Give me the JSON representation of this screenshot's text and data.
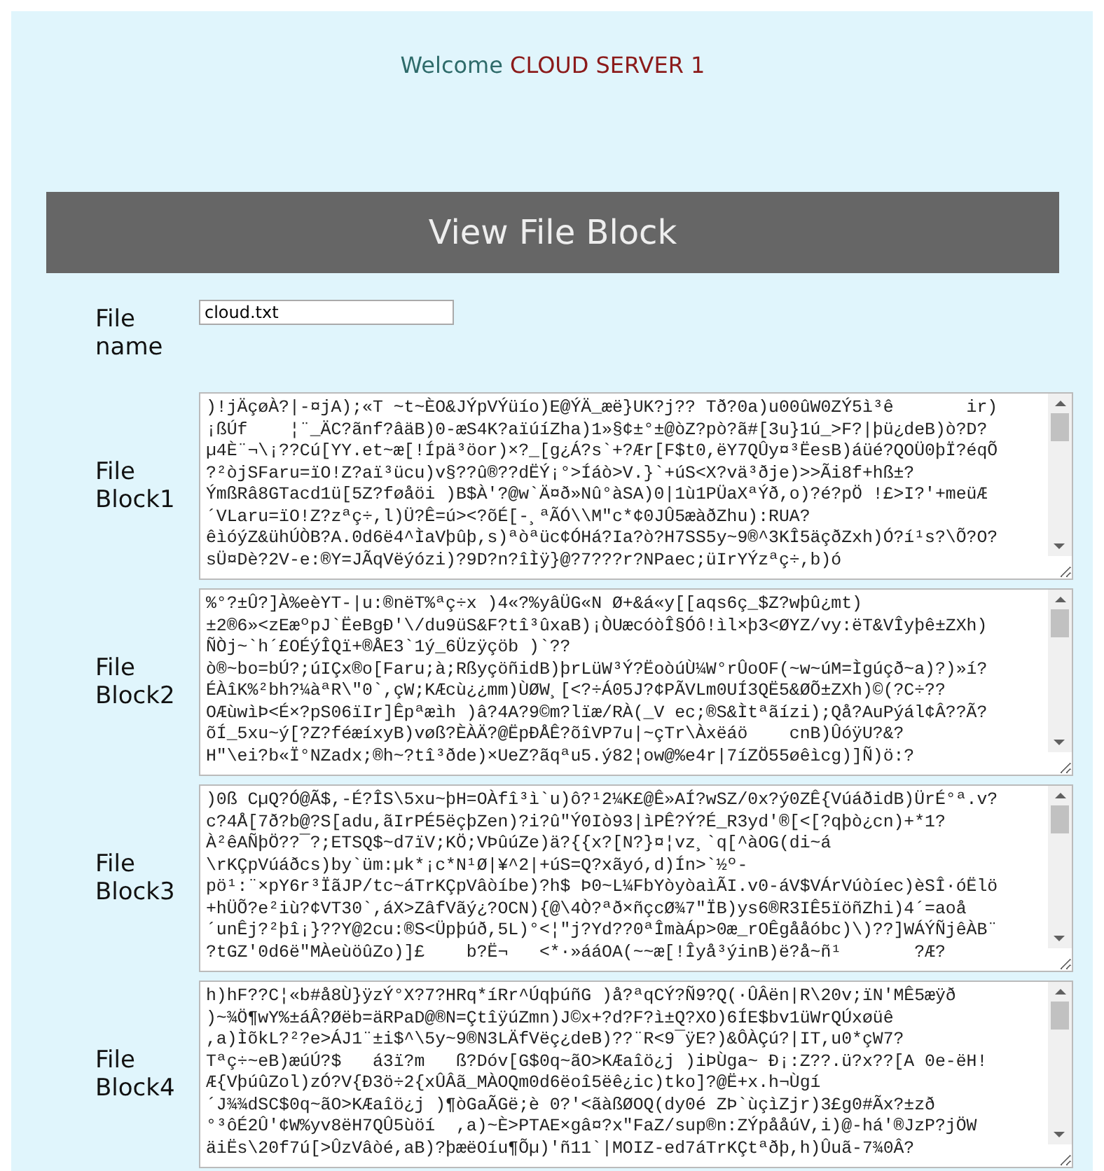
{
  "header": {
    "welcome": "Welcome",
    "server_name": "CLOUD SERVER 1"
  },
  "title": "View File Block",
  "file_name": {
    "label": "File name",
    "value": "cloud.txt"
  },
  "blocks": [
    {
      "label": "File Block1",
      "lines": [
        ")!jÄçøÀ?|-¤jA);«T ~t~ÈO&JÝpVÝüío)E@ÝÄ_æë}UK?j?? Tð?0a)u00ûW0ZÝ5ì³ê       ir)",
        "¡ßÚf    ¦¨_ÄC?ãnf?âäB)0-æS4K?aïúíZha)1»§¢±°±@òZ?pò?ã#[3u}1ú_>F?|þü¿deB)ò?D?",
        "µ4È¨¬\\¡??Cú[YY.et~æ[!Ípä³öor)×?_[g¿Á?s`+?Ær[F$t0,ëY7QÛy¤³ËesB)áüé?QOÜ0þÏ?éqÕ",
        "?²òjSFaru=ïO!Z?aï³ücu)v§??û®??dËÝ¡°>Íáò>V.}`+úS<X?vä³ðje)>>Ãi8f+hß±?",
        "ÝmßRâ8GTacd1ü[5Z?føåöi )B$À'?@w`Ä¤ð»Nû°àSA)0|1ù1PÜaXªÝð,o)?é?pÖ !£>I?'+meüÆ",
        "´VLaru=ïO!Z?zªç÷,l)Ü?Ê=ú><?õÉ[-¸ªÃÓ\\\\M\"c*¢0JÛ5æàðZhu):RUA?",
        "êìóýZ&ühÚÒB?A.0d6ë4^ÌaVþûþ,s)ªòªüc¢ÓHá?Ia?ò?H7SS5y~9®^3KÎ5äçðZxh)Ó?í¹s?\\Õ?O?",
        "sÜ¤Dè?2V-e:®Y=JÃqVëýózi)?9D?n?îÌÿ}@?7???r?NPaec;üIrYÝzªç÷,b)ó"
      ]
    },
    {
      "label": "File Block2",
      "lines": [
        "%°?±Û?]À%eèYT-|u:®nëT%ªç÷x )4«?%yâÜG«N Ø+&á«y[[aqs6ç_$Z?wþû¿mt)",
        "±2®6»<zEæºpJ`ËeBgÐ'\\/du9üS&F?tî³ûxaB)¡ÒUæcóòÎ§Óô!ìl×þ3<ØYZ/vy:ëT&VÎyþê±ZXh)",
        "ÑÒj~`h´£OÉýÎQï+®ÅE3`1ý_6Üzÿçöb )`??",
        "ò®~bo=bÚ?;úIÇx®o[Faru;à;RßyçöñidB)þrLüW³Ý?ËoòúÙ¼W°rÛoOF(~w~úM=Ìgúçð~a)?)»í?",
        "ÉÀîK%²bh?¼àªR\\\"0`,çW;KÆcù¿¿mm)ÙØW¸[<?÷Á05J?¢PÃVLm0UÍ3QË5&ØÕ±ZXh)©(?C÷??",
        "OÆùwìÞ<É×?pS06ïIr]Êpªæìh )â?4A?9©m?lïæ/RÀ(_V ec;®S&Ìtªãízi);Qå?AuPýál¢Â??Ã?",
        "õÍ_5xu~ý[?Z?féæíxyB)vøß?ÈÀÄ?@ËpÐÅÊ?õîVP7u|~çTr\\Àxëáö    cnB)ÛóÿU?&?",
        "H\"\\ei?b«Ï°NZadx;®h~?tî³ðde)×UeZ?ãqªu5.ý82¦ow@%e4r|7íZÖ55øêìcg)]Ñ)ö:?"
      ]
    },
    {
      "label": "File Block3",
      "lines": [
        ")0ß CµQ?Ó@Ã$,-É?ÎS\\5xu~þH=OÀfî³ì`u)ô?¹2¼K£@Ê»AÍ?wSZ/0x?ý0ZÊ{VúáðidB)ÜrÉ°ª.v?",
        "c?4Å[7ð?b@?S[adu,ãIrPÉ5ëçþZen)?i?û\"Ý0Iò93|ìPÊ?Ý?É_R3yd'®[<[?qþò¿cn)+*1?",
        "À²êAÑþÖ??¯?;ETSQ$~d7ïV;KÖ;VÞûúZe)ä?{{x?[N?}¤¦vz¸`q[^àOG(di~á",
        "\\rKÇpVúáðcs)by`üm:µk*¡c*N¹Ø|¥^2|+úS=Q?xãyó,d)Ín>`½º-",
        "pö¹:¨×pY6r³ÏãJP/tc~áTrKÇpVâòíbe)?h$ Þ0~L¼FbYòyòaìÃI.v0-áV$VÁrVúòíec)èSÎ·óËlö",
        "+hÜÕ?e²iù?¢VT30`,áX>ZâfVãý¿?OCN){@\\4Ò?ªð×ñçcØ¾7\"ÏB)ys6®R3IÊ5ïöñZhi)4´=aoå",
        "´unÊj?²þî¡}??Y@2cu:®S<Üpþúð,5L)°<¦\"j?Yd??0ªÎmàÁp>0æ_rOÊgååóbc)\\)??]WÁÝÑjêÀB¨",
        "?tGZ'0d6ë\"MÀeùöûZo)]£    b?Ë¬   <*·»ááOA(~~æ[!Îyå³ýinB)ë?å~ñ¹       ?Æ?"
      ]
    },
    {
      "label": "File Block4",
      "lines": [
        "h)hF??C¦«b#å8Ù}ÿzÝ°X?7?HRq*íRr^ÚqþúñG )å?ªqCÝ?Ñ9?Q(·ÛÂën|R\\20v;ïN'MÊ5æÿð",
        ")~¾Ö¶wY%±áÂ?Øëb=äRPaD@®N=ÇtîÿúZmn)J©x+?d?F?ì±Q?XO)6ÍE$bv1üWrQÚxøüê",
        ",a)ÌõkL?²?e>ÁJ1¨±i$^\\5y~9®N3LÄfVëç¿deB)??¨R<9¯ÿE?)&ÔÀÇú?|IT,u0*çW7?",
        "Tªç÷~eB)æúÚ?$   á3ï?m   ß?Dóv[G$0q~ãO>KÆaîö¿j )iÞÙga~ Ð¡:Z??.ü?x??[A 0e-ëH!",
        "Æ{VþúûZol)zÓ?V{Ð3ö÷2{xÛÂã_MÀOQm0d6ëoî5ëê¿ic)tko]?@Ë+x.h¬Ùgí",
        "´J¾¾dSC$0q~ãO>KÆaîö¿j )¶òGaÃGë;è 0?'<ãàßØOQ(dy0é ZÞ`ùçìZjr)3£g0#Ãx?±zð",
        "°³ôÉ2Û'¢W%yv8ëH7QÛ5ùöí  ,a)~È>PTAE×gâ¤?x\"FaZ/sup®n:ZÝpååúV,i)@-há'®JzP?jÖW",
        "äiËs\\20f7ú[>ÛzVâòé,aB)?þæëOíu¶Õµ)'ñ11`|MOIZ-ed7áTrKÇtªðþ,h)Ûuã-7¾0Â?"
      ]
    }
  ]
}
